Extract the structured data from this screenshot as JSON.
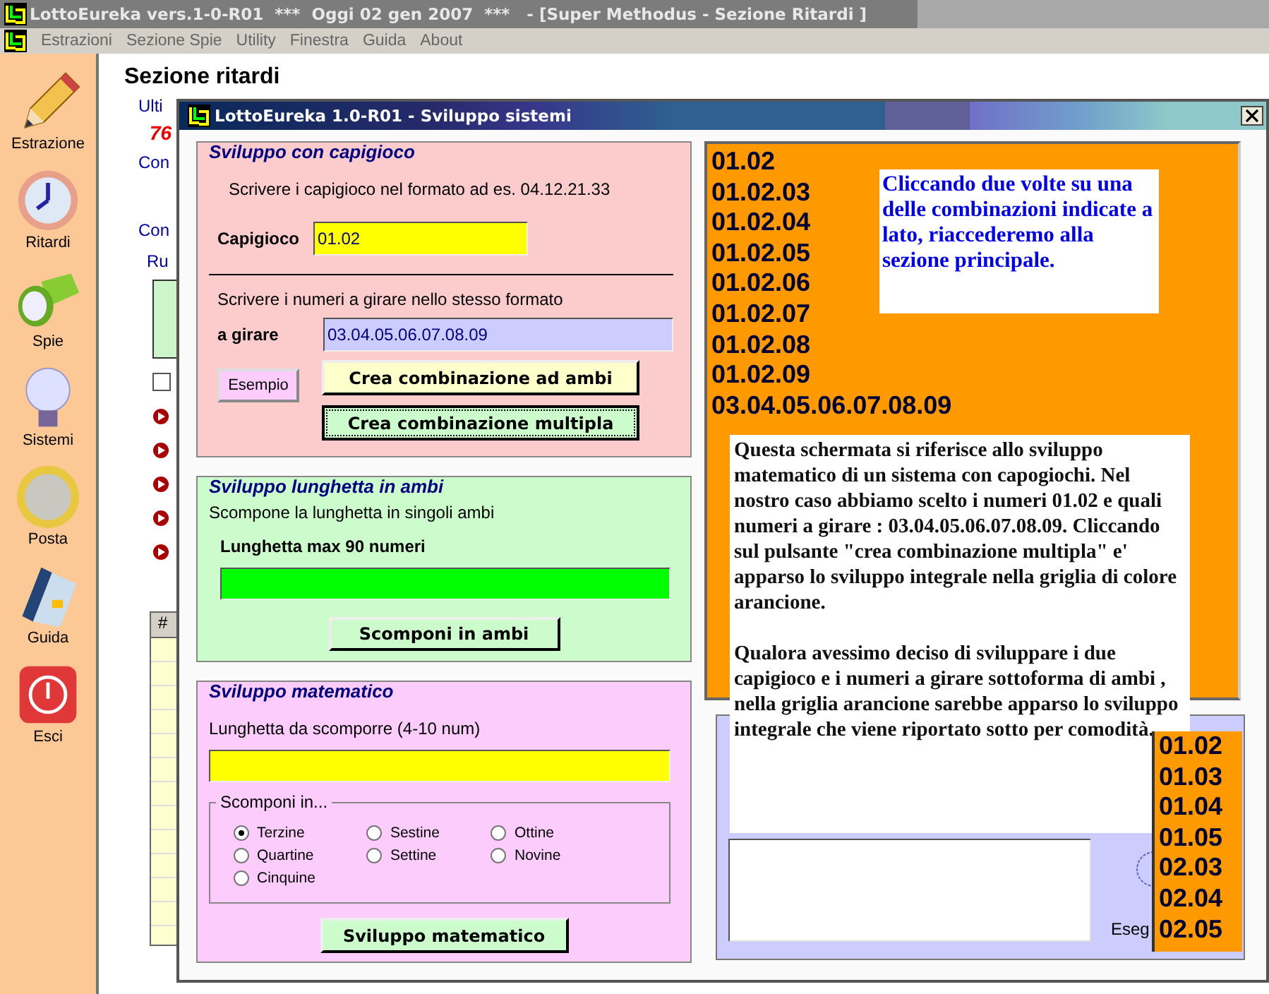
{
  "window": {
    "title": "LottoEureka vers.1-0-R01  ***  Oggi 02 gen 2007  ***   - [Super Methodus - Sezione Ritardi ]"
  },
  "menu": [
    "Estrazioni",
    "Sezione Spie",
    "Utility",
    "Finestra",
    "Guida",
    "About"
  ],
  "sidebar": [
    {
      "label": "Estrazione",
      "kind": "pencil"
    },
    {
      "label": "Ritardi",
      "kind": "clock"
    },
    {
      "label": "Spie",
      "kind": "flashlight"
    },
    {
      "label": "Sistemi",
      "kind": "bulb"
    },
    {
      "label": "Posta",
      "kind": "coin"
    },
    {
      "label": "Guida",
      "kind": "book"
    },
    {
      "label": "Esci",
      "kind": "power"
    }
  ],
  "section": {
    "title": "Sezione ritardi",
    "group_legend": "Ulti",
    "number": "76",
    "label_1": "Con",
    "label_2": "Con",
    "ruote_legend": "Ru",
    "checkbox_checked": false,
    "table_header": "#"
  },
  "dialog": {
    "title": "LottoEureka 1.0-R01 - Sviluppo sistemi",
    "capigioco": {
      "legend": "Sviluppo con capigioco",
      "hint": "Scrivere i capigioco nel formato ad es. 04.12.21.33",
      "label": "Capigioco",
      "value": "01.02",
      "hint_2": "Scrivere i numeri a girare nello stesso formato",
      "label_2": "a girare",
      "value_2": "03.04.05.06.07.08.09",
      "example_button": "Esempio",
      "button_ambi": "Crea combinazione ad ambi",
      "button_multipla": "Crea combinazione multipla"
    },
    "lunghetta": {
      "legend": "Sviluppo lunghetta in ambi",
      "hint": "Scompone la lunghetta in singoli ambi",
      "label": "Lunghetta max 90 numeri",
      "button": "Scomponi in ambi"
    },
    "matematico": {
      "legend": "Sviluppo matematico",
      "label": "Lunghetta da scomporre (4-10 num)",
      "group_legend": "Scomponi in...",
      "options": [
        {
          "label": "Terzine",
          "selected": true
        },
        {
          "label": "Quartine",
          "selected": false
        },
        {
          "label": "Cinquine",
          "selected": false
        },
        {
          "label": "Sestine",
          "selected": false
        },
        {
          "label": "Settine",
          "selected": false
        },
        {
          "label": "Ottine",
          "selected": false
        },
        {
          "label": "Novine",
          "selected": false
        }
      ],
      "button": "Sviluppo matematico"
    },
    "results": [
      "01.02",
      "01.02.03",
      "01.02.04",
      "01.02.05",
      "01.02.06",
      "01.02.07",
      "01.02.08",
      "01.02.09",
      "03.04.05.06.07.08.09"
    ],
    "note_1": "Cliccando due volte su una delle combinazioni indicate a lato, riaccederemo alla sezione principale.",
    "note_2": [
      "Questa schermata si riferisce allo sviluppo matematico di un sistema con capogiochi. Nel nostro caso abbiamo scelto i numeri 01.02 e quali numeri a girare : 03.04.05.06.07.08.09. Cliccando sul pulsante \"crea combinazione multipla\" e' apparso lo sviluppo integrale nella griglia di colore arancione.",
      "Qualora avessimo deciso di sviluppare i due capigioco e i numeri a girare sottoforma di ambi , nella griglia arancione sarebbe apparso lo sviluppo integrale che viene riportato sotto per comodità."
    ],
    "execute_label": "Eseg",
    "ambi": [
      "01.02",
      "01.03",
      "01.04",
      "01.05",
      "02.03",
      "02.04",
      "02.05"
    ]
  }
}
